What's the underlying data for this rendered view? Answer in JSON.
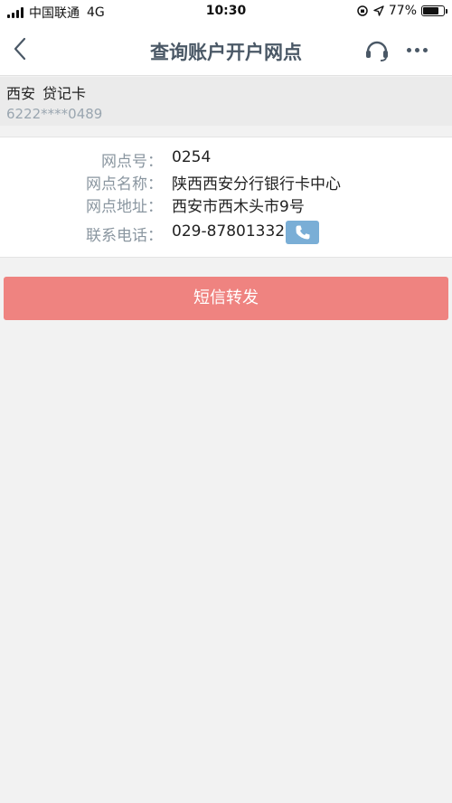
{
  "status_bar": {
    "carrier": "中国联通",
    "network": "4G",
    "time": "10:30",
    "battery_percent": "77%",
    "battery_level": 0.77
  },
  "nav": {
    "title": "查询账户开户网点",
    "back_icon": "chevron-left-icon",
    "service_icon": "headset-icon",
    "more_icon": "more-dots-icon"
  },
  "account": {
    "city": "西安",
    "card_type": "贷记卡",
    "number": "6222****0489"
  },
  "branch": {
    "rows": [
      {
        "label": "网点号：",
        "value": "0254"
      },
      {
        "label": "网点名称：",
        "value": "陕西西安分行银行卡中心"
      },
      {
        "label": "网点地址：",
        "value": "西安市西木头市9号"
      },
      {
        "label": "联系电话：",
        "value": "029-87801332"
      }
    ],
    "phone_icon": "phone-icon"
  },
  "actions": {
    "sms_forward": "短信转发"
  },
  "colors": {
    "primary_button": "#ef8380",
    "phone_button": "#7aaed6",
    "title_text": "#4a5866"
  }
}
